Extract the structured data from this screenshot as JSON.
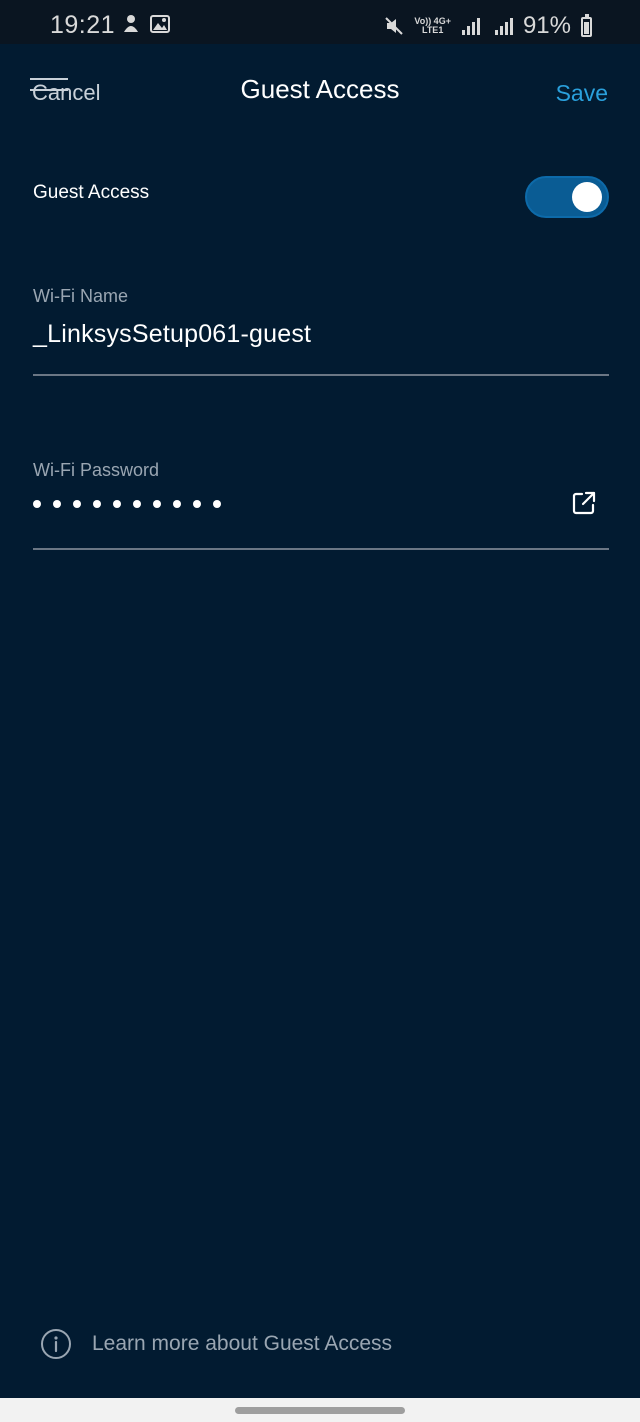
{
  "status_bar": {
    "time": "19:21",
    "network_top": "Vo)) 4G+",
    "network_bottom": "LTE1",
    "battery": "91%"
  },
  "header": {
    "cancel_label": "Cancel",
    "title": "Guest Access",
    "save_label": "Save"
  },
  "guest_toggle": {
    "label": "Guest Access",
    "enabled": true
  },
  "wifi_name": {
    "label": "Wi-Fi Name",
    "value": "_LinksysSetup061-guest"
  },
  "wifi_password": {
    "label": "Wi-Fi Password",
    "masked_length": 10
  },
  "footer": {
    "learn_more": "Learn more about Guest Access"
  },
  "colors": {
    "background": "#021b31",
    "accent": "#2aa0dc",
    "toggle_on": "#0a5c94"
  },
  "icons": [
    "info-icon",
    "share-icon",
    "mute-icon",
    "signal-icon",
    "battery-icon"
  ]
}
